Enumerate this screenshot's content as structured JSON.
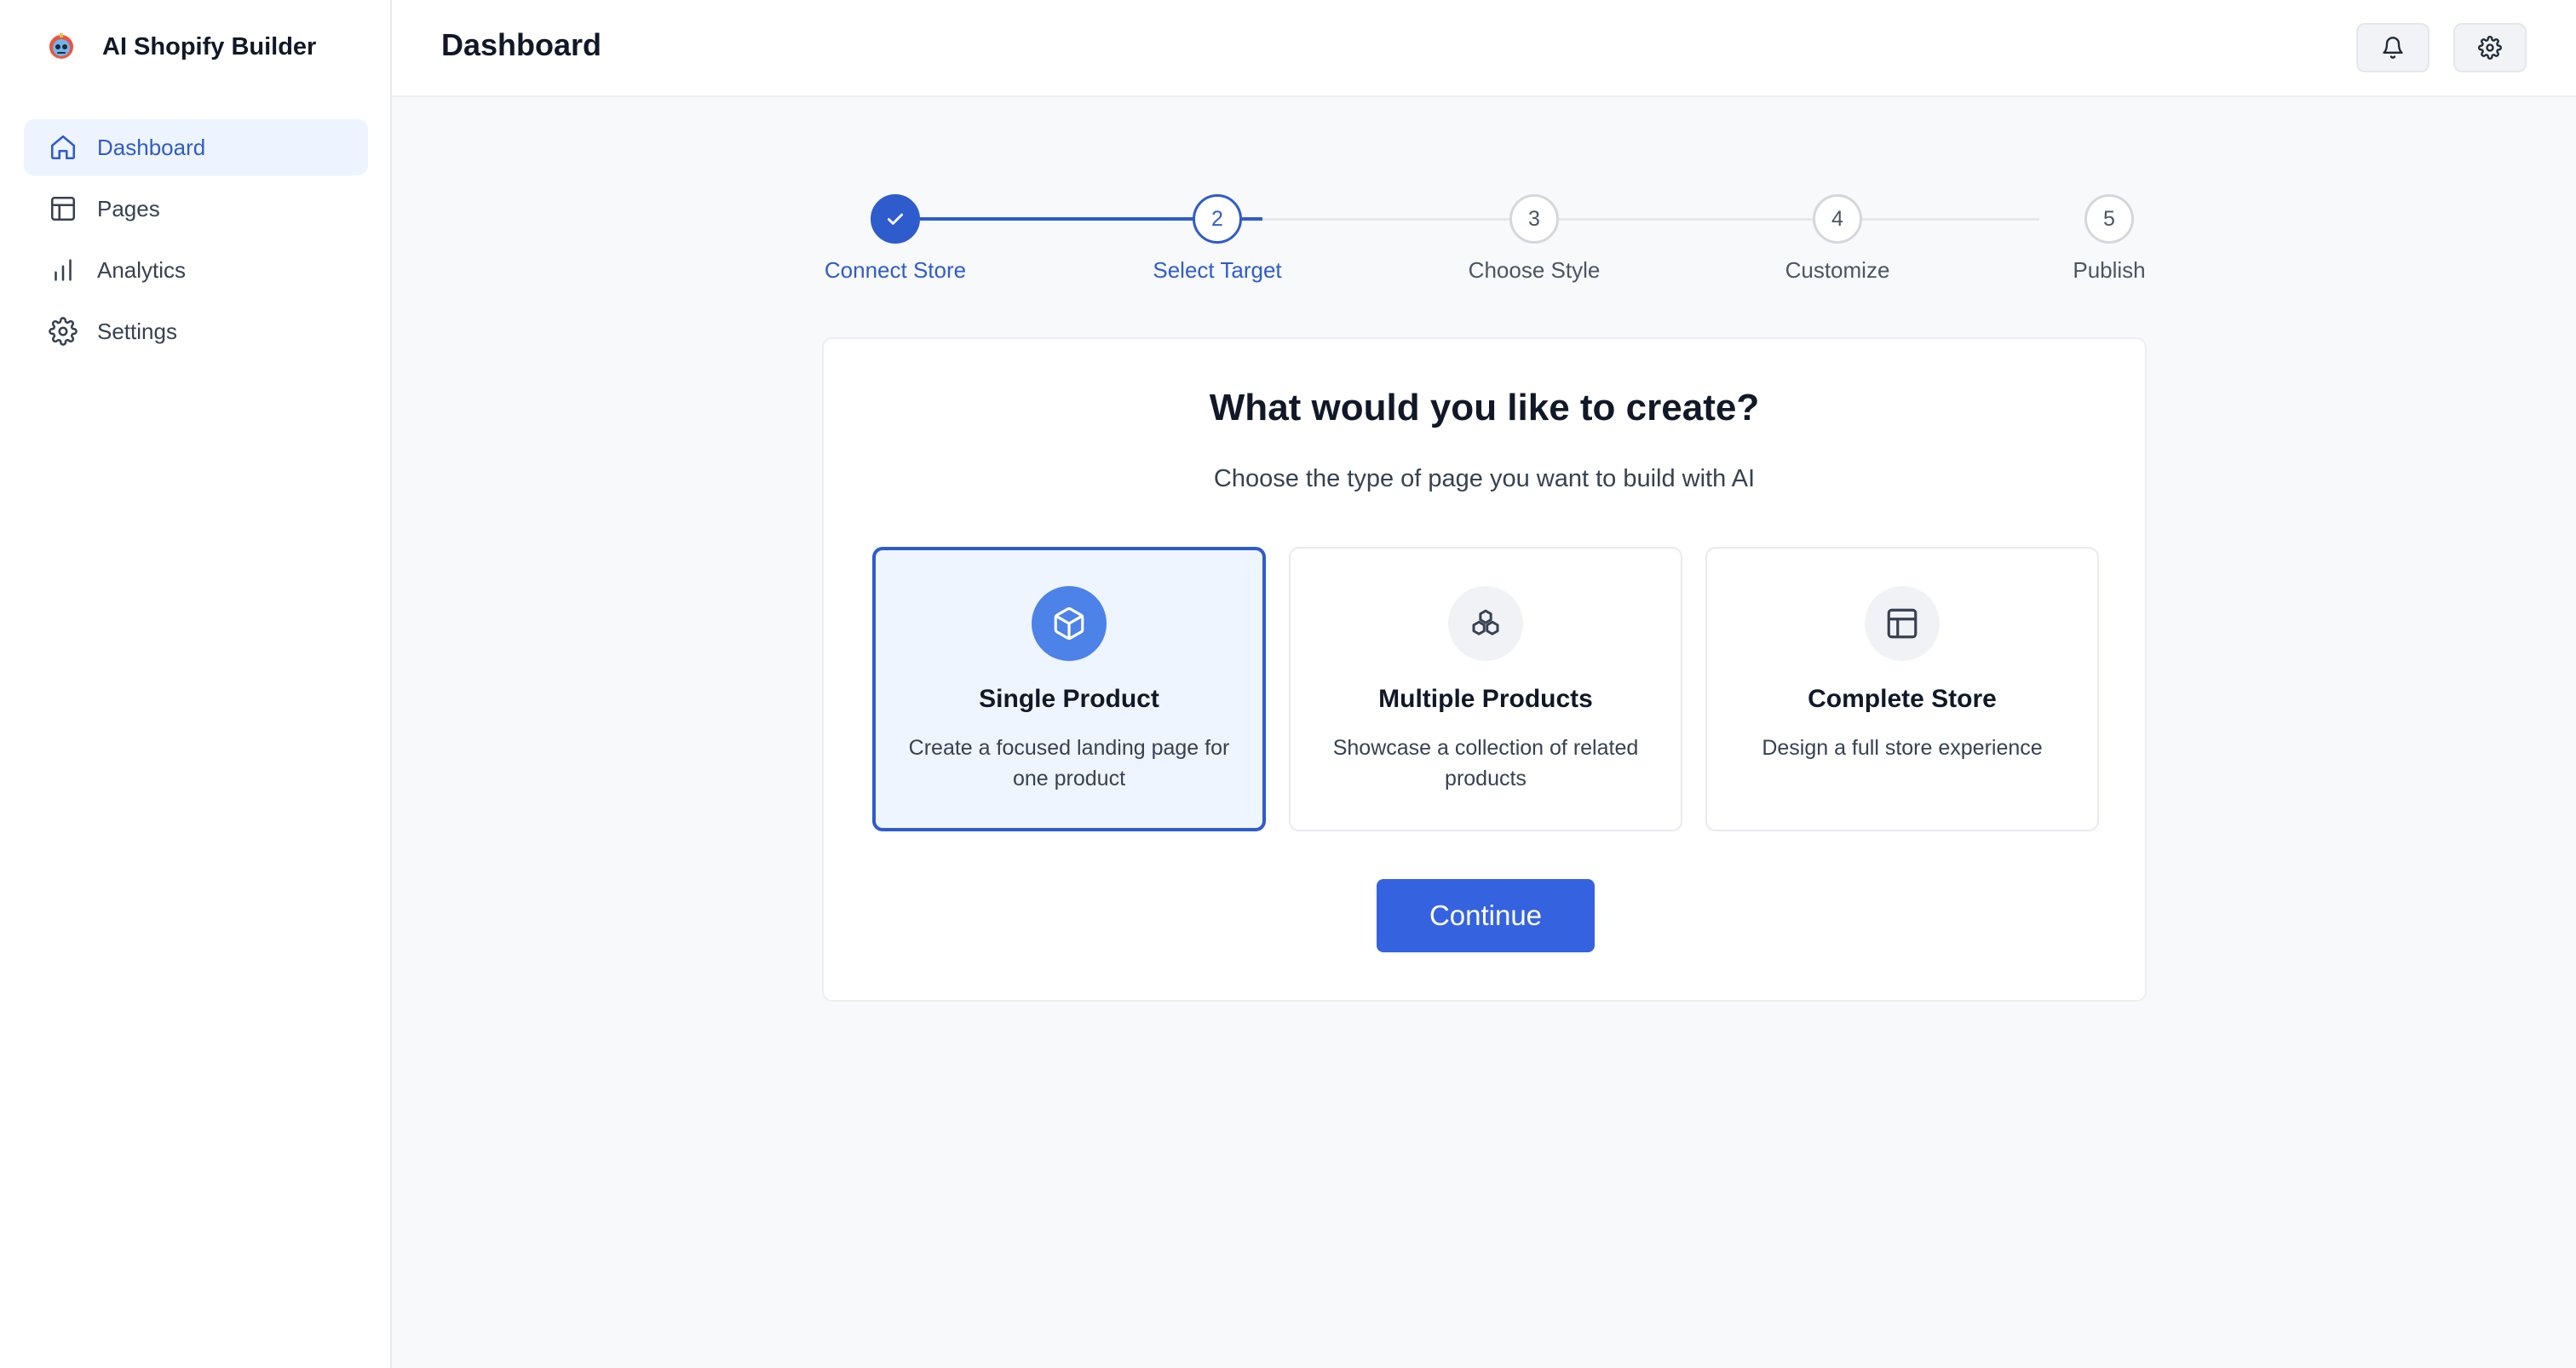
{
  "app": {
    "name": "AI Shopify Builder",
    "logo_icon": "robot-logo"
  },
  "sidebar": {
    "items": [
      {
        "label": "Dashboard",
        "icon": "home-icon",
        "active": true
      },
      {
        "label": "Pages",
        "icon": "layout-icon",
        "active": false
      },
      {
        "label": "Analytics",
        "icon": "bar-chart-icon",
        "active": false
      },
      {
        "label": "Settings",
        "icon": "gear-icon",
        "active": false
      }
    ]
  },
  "header": {
    "title": "Dashboard",
    "buttons": [
      {
        "icon": "bell-icon"
      },
      {
        "icon": "gear-icon"
      }
    ]
  },
  "stepper": {
    "steps": [
      {
        "number": "1",
        "label": "Connect Store",
        "state": "complete"
      },
      {
        "number": "2",
        "label": "Select Target",
        "state": "current"
      },
      {
        "number": "3",
        "label": "Choose Style",
        "state": "upcoming"
      },
      {
        "number": "4",
        "label": "Customize",
        "state": "upcoming"
      },
      {
        "number": "5",
        "label": "Publish",
        "state": "upcoming"
      }
    ]
  },
  "card": {
    "title": "What would you like to create?",
    "subtitle": "Choose the type of page you want to build with AI",
    "options": [
      {
        "title": "Single Product",
        "description": "Create a focused landing page for one product",
        "icon": "cube-icon",
        "selected": true
      },
      {
        "title": "Multiple Products",
        "description": "Showcase a collection of related products",
        "icon": "cubes-icon",
        "selected": false
      },
      {
        "title": "Complete Store",
        "description": "Design a full store experience",
        "icon": "layout-icon",
        "selected": false
      }
    ],
    "continue_label": "Continue"
  },
  "colors": {
    "accent": "#2f5ccc",
    "button": "#3563e0",
    "selected_bg": "#eff5ff",
    "active_nav_bg": "#eef4ff"
  }
}
